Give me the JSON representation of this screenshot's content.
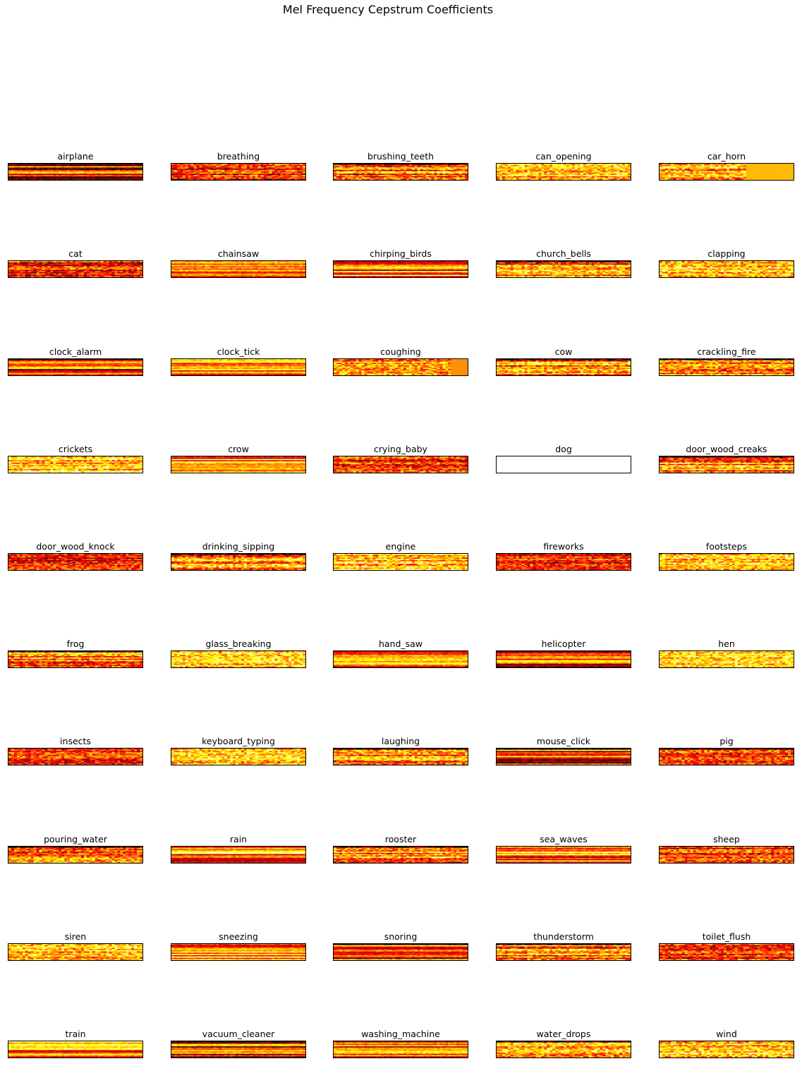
{
  "figure": {
    "title": "Mel Frequency Cepstrum Coefficients"
  },
  "colormap": {
    "name": "hot",
    "stops": [
      "#000000",
      "#8b0000",
      "#ff0000",
      "#ff8c00",
      "#ffff00",
      "#ffffff"
    ]
  },
  "chart_data": {
    "type": "heatmap",
    "description_of_panels": "grid of 50 small MFCC heatmaps, 10 rows x 5 columns, one per sound class",
    "rows": 10,
    "cols": 5,
    "panels": [
      {
        "label": "airplane",
        "style": "stripes_dark",
        "uniform": null
      },
      {
        "label": "breathing",
        "style": "red_mottled",
        "uniform": null
      },
      {
        "label": "brushing_teeth",
        "style": "mixed",
        "uniform": null
      },
      {
        "label": "can_opening",
        "style": "yellow_mottled",
        "uniform": null
      },
      {
        "label": "car_horn",
        "style": "partial_fill",
        "uniform": "#ffb800"
      },
      {
        "label": "cat",
        "style": "red_mottled",
        "uniform": null
      },
      {
        "label": "chainsaw",
        "style": "stripes_light",
        "uniform": null
      },
      {
        "label": "chirping_birds",
        "style": "stripes_light",
        "uniform": null
      },
      {
        "label": "church_bells",
        "style": "mixed",
        "uniform": null
      },
      {
        "label": "clapping",
        "style": "yellow_mottled",
        "uniform": null
      },
      {
        "label": "clock_alarm",
        "style": "stripes_dark",
        "uniform": null
      },
      {
        "label": "clock_tick",
        "style": "stripes_light",
        "uniform": null
      },
      {
        "label": "coughing",
        "style": "partial_fill",
        "uniform": "#ff8c00"
      },
      {
        "label": "cow",
        "style": "mixed",
        "uniform": null
      },
      {
        "label": "crackling_fire",
        "style": "mixed",
        "uniform": null
      },
      {
        "label": "crickets",
        "style": "yellow_mottled",
        "uniform": null
      },
      {
        "label": "crow",
        "style": "stripes_light",
        "uniform": null
      },
      {
        "label": "crying_baby",
        "style": "red_mottled",
        "uniform": null
      },
      {
        "label": "dog",
        "style": "empty",
        "uniform": null
      },
      {
        "label": "door_wood_creaks",
        "style": "mixed",
        "uniform": null
      },
      {
        "label": "door_wood_knock",
        "style": "red_mottled",
        "uniform": null
      },
      {
        "label": "drinking_sipping",
        "style": "mixed",
        "uniform": null
      },
      {
        "label": "engine",
        "style": "yellow_mottled",
        "uniform": null
      },
      {
        "label": "fireworks",
        "style": "red_mottled",
        "uniform": null
      },
      {
        "label": "footsteps",
        "style": "yellow_mottled",
        "uniform": null
      },
      {
        "label": "frog",
        "style": "mixed",
        "uniform": null
      },
      {
        "label": "glass_breaking",
        "style": "yellow_mottled",
        "uniform": null
      },
      {
        "label": "hand_saw",
        "style": "stripes_light",
        "uniform": null
      },
      {
        "label": "helicopter",
        "style": "stripes_dark",
        "uniform": null
      },
      {
        "label": "hen",
        "style": "yellow_mottled",
        "uniform": null
      },
      {
        "label": "insects",
        "style": "red_mottled",
        "uniform": null
      },
      {
        "label": "keyboard_typing",
        "style": "yellow_mottled",
        "uniform": null
      },
      {
        "label": "laughing",
        "style": "mixed",
        "uniform": null
      },
      {
        "label": "mouse_click",
        "style": "stripes_dark",
        "uniform": null
      },
      {
        "label": "pig",
        "style": "mixed",
        "uniform": null
      },
      {
        "label": "pouring_water",
        "style": "mixed",
        "uniform": null
      },
      {
        "label": "rain",
        "style": "stripes_light",
        "uniform": null
      },
      {
        "label": "rooster",
        "style": "mixed",
        "uniform": null
      },
      {
        "label": "sea_waves",
        "style": "stripes_light",
        "uniform": null
      },
      {
        "label": "sheep",
        "style": "red_mottled",
        "uniform": null
      },
      {
        "label": "siren",
        "style": "yellow_mottled",
        "uniform": null
      },
      {
        "label": "sneezing",
        "style": "stripes_light",
        "uniform": null
      },
      {
        "label": "snoring",
        "style": "stripes_dark",
        "uniform": null
      },
      {
        "label": "thunderstorm",
        "style": "mixed",
        "uniform": null
      },
      {
        "label": "toilet_flush",
        "style": "red_mottled",
        "uniform": null
      },
      {
        "label": "train",
        "style": "stripes_light",
        "uniform": null
      },
      {
        "label": "vacuum_cleaner",
        "style": "stripes_dark",
        "uniform": null
      },
      {
        "label": "washing_machine",
        "style": "stripes_light",
        "uniform": null
      },
      {
        "label": "water_drops",
        "style": "mixed",
        "uniform": null
      },
      {
        "label": "wind",
        "style": "yellow_mottled",
        "uniform": null
      }
    ]
  }
}
